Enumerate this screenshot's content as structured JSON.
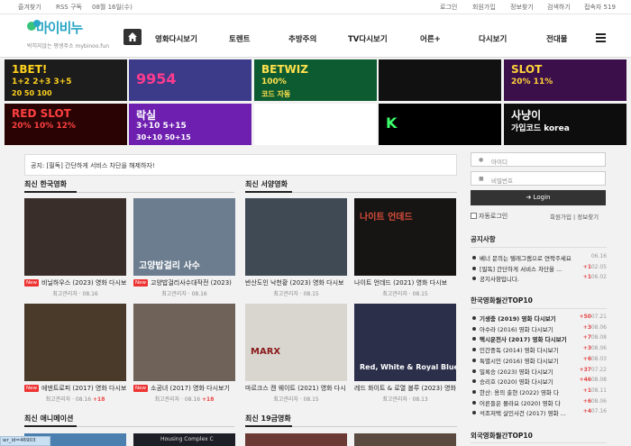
{
  "topbar": {
    "left": [
      "즐겨찾기",
      "RSS 구독",
      "08월 16일(수)"
    ],
    "right": [
      "로그인",
      "회원가입",
      "정보찾기",
      "검색하기",
      "접속자 519"
    ]
  },
  "header": {
    "logo_title": "마이비누",
    "logo_sub": "박히지않는 평생주소 mybinoo.fun",
    "nav": [
      "영화다시보기",
      "토렌트",
      "추방주의",
      "TV다시보기",
      "어른+",
      "다시보기",
      "전대물"
    ]
  },
  "banners": [
    {
      "name": "1BET",
      "lines": [
        "1BET!",
        "1+2 2+3 3+5",
        "20 50 100"
      ],
      "bg": "#1c1c1c",
      "fg": "#ffd21e"
    },
    {
      "name": "winner",
      "lines": [
        "9954"
      ],
      "bg": "#3b3b8a",
      "fg": "#ff3b8c"
    },
    {
      "name": "BETWIZ",
      "lines": [
        "BETWIZ",
        "100%",
        "코드 자동"
      ],
      "bg": "#0d5b30",
      "fg": "#ffe14d"
    },
    {
      "name": "golden",
      "lines": [],
      "bg": "#111111",
      "fg": "#e1b33c"
    },
    {
      "name": "magic-slot",
      "lines": [
        "SLOT",
        "20% 11%"
      ],
      "bg": "#3a0f4a",
      "fg": "#ffd23b"
    },
    {
      "name": "RED SLOT",
      "lines": [
        "RED SLOT",
        "20% 10% 12%"
      ],
      "bg": "#2a0404",
      "fg": "#ff4040"
    },
    {
      "name": "락실",
      "lines": [
        "락실",
        "3+10 5+15",
        "30+10 50+15"
      ],
      "bg": "#6e1fb0",
      "fg": "#ffffff"
    },
    {
      "name": "character",
      "lines": [],
      "bg": "#ffffff",
      "fg": "#d84a2a"
    },
    {
      "name": "K",
      "lines": [
        "K"
      ],
      "bg": "#000000",
      "fg": "#3cff6b"
    },
    {
      "name": "사냥이",
      "lines": [
        "사냥이",
        "가입코드 korea"
      ],
      "bg": "#0d0d0d",
      "fg": "#ffffff"
    }
  ],
  "notice": "공지: [필독] 간단하게 서비스 차단을 해제하자!",
  "sections": {
    "korean": "최신 한국영화",
    "western": "최신 서양영화",
    "animation": "최신 애니메이션",
    "adult": "최신 19금영화"
  },
  "cards": [
    {
      "title": "비닐하우스 (2023) 영화 다시보",
      "meta": "최고관리자 · 08.16",
      "new": "New",
      "hot": "",
      "bg": "#3a2e2a",
      "caption": ""
    },
    {
      "title": "고양밥걸리사수대작전 (2023)",
      "meta": "최고관리자 · 08.16",
      "new": "New",
      "hot": "",
      "bg": "#6b7d8f",
      "caption": "고양밥걸리 사수"
    },
    {
      "title": "반산도인 낙천황 (2023) 영화 다시보",
      "meta": "최고관리자 · 08.15",
      "new": "",
      "hot": "",
      "bg": "#3f4a55",
      "caption": ""
    },
    {
      "title": "나이트 언데드 (2021) 영화 다시보",
      "meta": "최고관리자 · 08.15",
      "new": "",
      "hot": "",
      "bg": "#171414",
      "caption": "나이트 언데드"
    },
    {
      "title": "에덴트로피 (2017) 영화 다시보기",
      "meta": "최고관리자 · 08.16",
      "new": "New",
      "hot": "+18",
      "bg": "#4a3a2a",
      "caption": ""
    },
    {
      "title": "소공녀 (2017) 영화 다시보기",
      "meta": "최고관리자 · 08.16",
      "new": "New",
      "hot": "+18",
      "bg": "#6f6258",
      "caption": ""
    },
    {
      "title": "마르크스 캔 웨이트 (2021) 영화 다시",
      "meta": "최고관리자 · 08.15",
      "new": "",
      "hot": "",
      "bg": "#d9d6d0",
      "caption": "MARX"
    },
    {
      "title": "레드 화이트 & 로열 블루 (2023) 영화",
      "meta": "최고관리자 · 08.13",
      "new": "",
      "hot": "",
      "bg": "#2b2f4a",
      "caption": "Red, White & Royal Blue"
    }
  ],
  "bottom_thumbs": [
    "",
    "Housing Complex C",
    "",
    ""
  ],
  "sidebar": {
    "id_placeholder": "아이디",
    "pw_placeholder": "비밀번호",
    "login_label": "Login",
    "autologin": "자동로그인",
    "links": "회원가입 | 정보찾기",
    "notice_title": "공지사항",
    "notices": [
      {
        "t": "베너 문의는 텔레그램으로 연락주세요",
        "n": "",
        "d": "06.16"
      },
      {
        "t": "[필독] 간단하게 서비스 차단을 ...",
        "n": "+1",
        "d": "02.05"
      },
      {
        "t": "공지사항입니다.",
        "n": "+1",
        "d": "06.02"
      }
    ],
    "korean_title": "한국영화월간TOP10",
    "korean_top": [
      {
        "t": "기생충 (2019) 영화 다시보기",
        "n": "+50",
        "d": "07.21",
        "bold": true
      },
      {
        "t": "아수라 (2016) 영화 다시보기",
        "n": "+3",
        "d": "08.06",
        "bold": false
      },
      {
        "t": "택시운전사 (2017) 영화 다시보기",
        "n": "+7",
        "d": "08.08",
        "bold": true
      },
      {
        "t": "인간중독 (2014) 영화 다시보기",
        "n": "+3",
        "d": "08.06",
        "bold": false
      },
      {
        "t": "특별시민 (2016) 영화 다시보기",
        "n": "+6",
        "d": "08.03",
        "bold": false
      },
      {
        "t": "밀록승 (2023) 영화 다시보기",
        "n": "+37",
        "d": "07.22",
        "bold": false
      },
      {
        "t": "승리호 (2020) 영화 다시보기",
        "n": "+46",
        "d": "08.08",
        "bold": false
      },
      {
        "t": "한산: 용의 출현 (2022) 영화 다",
        "n": "+1",
        "d": "08.11",
        "bold": false
      },
      {
        "t": "어른들은 몰라요 (2020) 영화 다",
        "n": "+6",
        "d": "08.06",
        "bold": false
      },
      {
        "t": "석조저택 살인사건 (2017) 영화 ...",
        "n": "+4",
        "d": "07.16",
        "bold": false
      }
    ],
    "western_title": "외국영화월간TOP10"
  },
  "statusbar": "wr_id=46903",
  "colors": {
    "accent": "#2aa6c6",
    "new_badge": "#e33333",
    "hot": "#e44444",
    "dark": "#333333"
  }
}
